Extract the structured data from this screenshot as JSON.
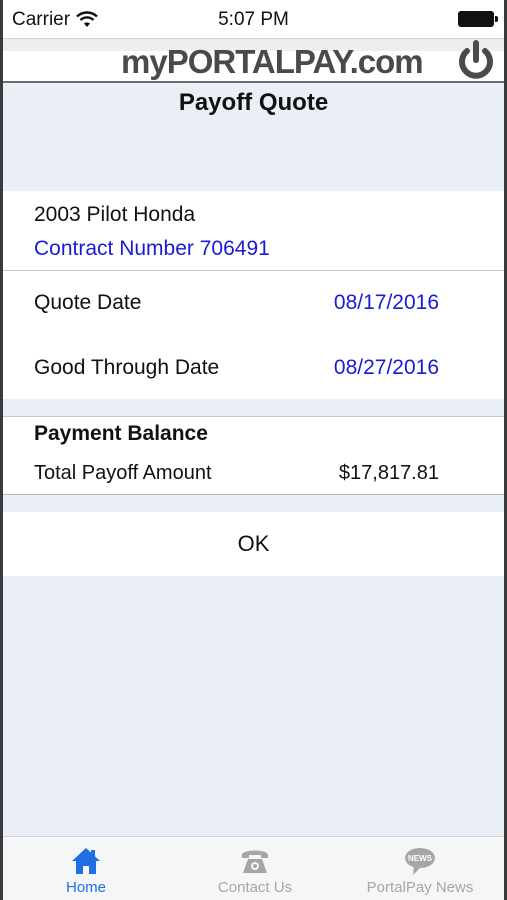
{
  "status_bar": {
    "carrier": "Carrier",
    "time": "5:07 PM"
  },
  "header": {
    "logo": "myPORTALPAY.com"
  },
  "page": {
    "title": "Payoff Quote"
  },
  "vehicle": {
    "name": "2003 Pilot Honda",
    "contract": "Contract Number 706491"
  },
  "quote": {
    "quote_date_label": "Quote Date",
    "quote_date_value": "08/17/2016",
    "good_through_label": "Good Through Date",
    "good_through_value": "08/27/2016"
  },
  "balance": {
    "title": "Payment Balance",
    "total_label": "Total Payoff Amount",
    "total_value": "$17,817.81"
  },
  "actions": {
    "ok_label": "OK"
  },
  "tab_bar": {
    "items": [
      {
        "label": "Home",
        "icon": "home-icon",
        "active": true
      },
      {
        "label": "Contact Us",
        "icon": "phone-icon",
        "active": false
      },
      {
        "label": "PortalPay News",
        "icon": "news-bubble-icon",
        "active": false
      }
    ],
    "news_icon_text": "NEWS"
  },
  "colors": {
    "accent": "#1f6ee6",
    "link": "#1a1adc",
    "background": "#e9eef7",
    "inactive": "#a6a6a6"
  }
}
